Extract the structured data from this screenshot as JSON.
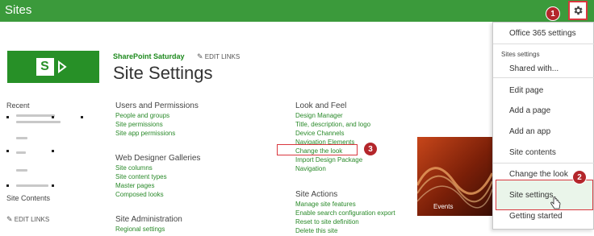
{
  "topbar": {
    "title": "Sites"
  },
  "header": {
    "site_link": "SharePoint Saturday",
    "edit_links": "EDIT LINKS",
    "page_title": "Site Settings"
  },
  "left_nav": {
    "recent": "Recent",
    "site_contents": "Site Contents",
    "edit_links": "EDIT LINKS"
  },
  "sections": {
    "users": {
      "title": "Users and Permissions",
      "links": [
        "People and groups",
        "Site permissions",
        "Site app permissions"
      ]
    },
    "web_designer": {
      "title": "Web Designer Galleries",
      "links": [
        "Site columns",
        "Site content types",
        "Master pages",
        "Composed looks"
      ]
    },
    "site_admin": {
      "title": "Site Administration",
      "links": [
        "Regional settings"
      ]
    },
    "look_feel": {
      "title": "Look and Feel",
      "links": [
        "Design Manager",
        "Title, description, and logo",
        "Device Channels",
        "Navigation Elements",
        "Change the look",
        "Import Design Package",
        "Navigation"
      ]
    },
    "site_actions": {
      "title": "Site Actions",
      "links": [
        "Manage site features",
        "Enable search configuration export",
        "Reset to site definition",
        "Delete this site"
      ]
    }
  },
  "tile": {
    "label": "Events"
  },
  "menu": {
    "office365": "Office 365 settings",
    "sites_settings_header": "Sites settings",
    "shared_with": "Shared with...",
    "items": [
      "Edit page",
      "Add a page",
      "Add an app",
      "Site contents",
      "Change the look",
      "Site settings",
      "Getting started"
    ]
  },
  "annotations": {
    "one": "1",
    "two": "2",
    "three": "3"
  },
  "colors": {
    "brand": "#3b9a3b",
    "link": "#2a8a2a",
    "annotation": "#d9373e"
  }
}
